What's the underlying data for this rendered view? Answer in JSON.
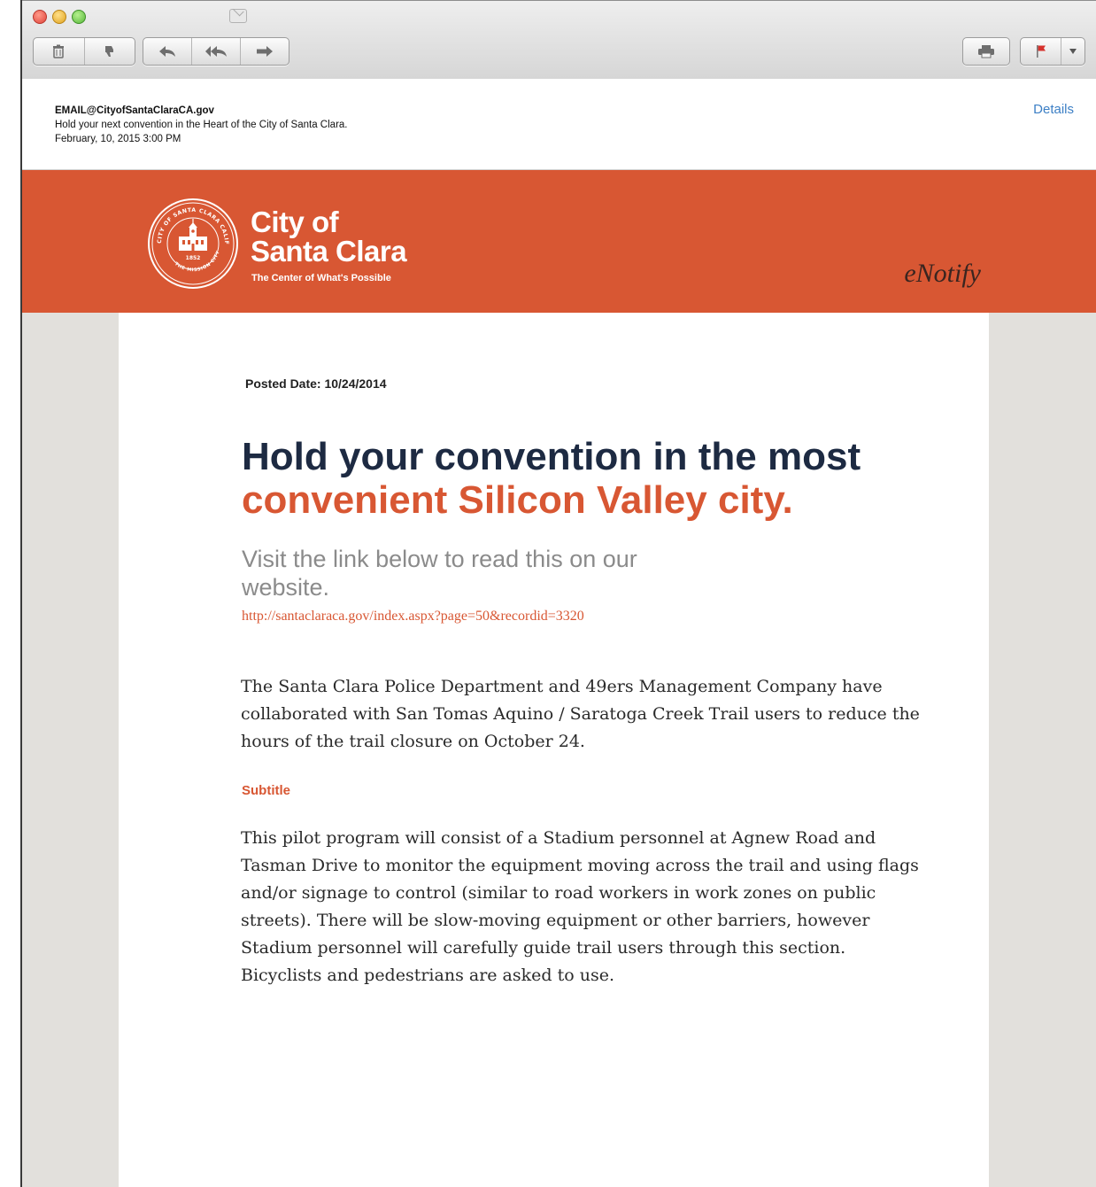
{
  "toolbar": {
    "icons": [
      "trash-icon",
      "junk-icon",
      "reply-icon",
      "reply-all-icon",
      "forward-icon",
      "print-icon",
      "flag-icon",
      "chevron-down-icon"
    ]
  },
  "header": {
    "from": "EMAIL@CityofSantaClaraCA.gov",
    "subject": "Hold your next convention in the Heart of the City of Santa Clara.",
    "date": "February, 10, 2015  3:00 PM",
    "details_label": "Details"
  },
  "banner": {
    "city_line1": "City of",
    "city_line2": "Santa Clara",
    "tagline": "The Center of What's Possible",
    "product": "eNotify",
    "seal_top_text": "CITY OF SANTA CLARA CALIFORNIA",
    "seal_bottom_text": "THE MISSION CITY",
    "seal_year": "1852",
    "color": "#d85733"
  },
  "article": {
    "posted": "Posted Date: 10/24/2014",
    "headline_dark": "Hold your convention in the most",
    "headline_orange": "convenient Silicon Valley city.",
    "visit_text": "Visit the link below to read this on our website.",
    "link": "http://santaclaraca.gov/index.aspx?page=50&recordid=3320",
    "paragraph1": "The Santa Clara Police Department and 49ers Management Company have collaborated with San Tomas Aquino / Saratoga Creek Trail users to reduce the hours of the trail closure on October 24.",
    "subtitle": "Subtitle",
    "paragraph2": "This pilot program will consist of a Stadium personnel at Agnew Road and Tasman Drive to monitor the equipment moving across the trail and using flags and/or signage to control (similar to road workers in work zones on public streets). There will be slow-moving equipment or other barriers, however Stadium personnel will carefully guide trail users through this section. Bicyclists and pedestrians are asked to use."
  }
}
